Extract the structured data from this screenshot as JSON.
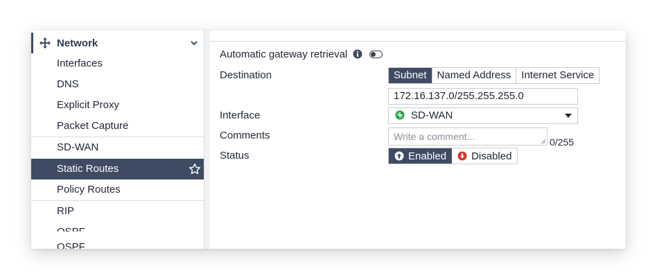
{
  "sidebar": {
    "section_title": "Network",
    "items": [
      {
        "label": "Interfaces"
      },
      {
        "label": "DNS"
      },
      {
        "label": "Explicit Proxy"
      },
      {
        "label": "Packet Capture"
      },
      {
        "label": "SD-WAN"
      },
      {
        "label": "Static Routes",
        "active": true
      },
      {
        "label": "Policy Routes"
      },
      {
        "label": "RIP"
      },
      {
        "label": "OSPF"
      },
      {
        "label": "OSPF"
      }
    ]
  },
  "form": {
    "gateway_label": "Automatic gateway retrieval",
    "gateway_enabled": false,
    "destination_label": "Destination",
    "destination_options": [
      "Subnet",
      "Named Address",
      "Internet Service"
    ],
    "destination_selected": "Subnet",
    "destination_value": "172.16.137.0/255.255.255.0",
    "interface_label": "Interface",
    "interface_value": "SD-WAN",
    "comments_label": "Comments",
    "comments_placeholder": "Write a comment...",
    "comments_counter": "0/255",
    "status_label": "Status",
    "status_enabled": "Enabled",
    "status_disabled": "Disabled",
    "status_selected": "Enabled"
  },
  "colors": {
    "active_bg": "#3f4b63",
    "sdwan_icon": "#1e9e3a",
    "disabled_icon": "#d9362b"
  }
}
